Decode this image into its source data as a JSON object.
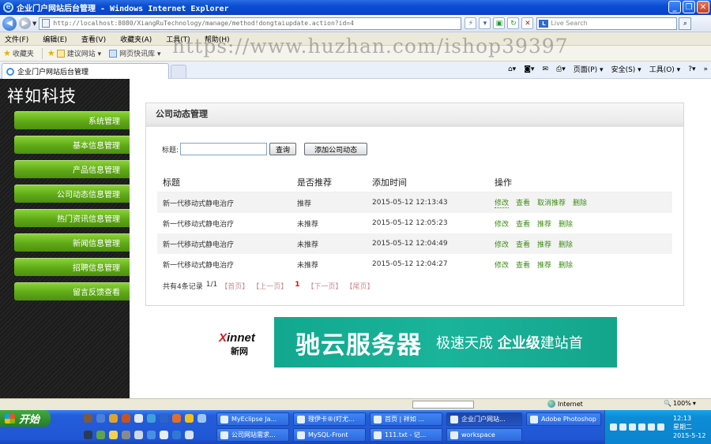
{
  "window": {
    "title": "企业门户网站后台管理 - Windows Internet Explorer",
    "address": "http://localhost:8080/XiangRuTechnology/manage/method!dongtaiupdate.action?id=4",
    "address_host": "localhost",
    "search_placeholder": "Live Search"
  },
  "menubar": [
    "文件(F)",
    "编辑(E)",
    "查看(V)",
    "收藏夹(A)",
    "工具(T)",
    "帮助(H)"
  ],
  "favorites": {
    "label": "收藏夹",
    "items": [
      "建议网站 ▾",
      "网页快讯库 ▾"
    ]
  },
  "watermark": "https://www.huzhan.com/ishop39397",
  "tab": {
    "title": "企业门户网站后台管理"
  },
  "tools": [
    "页面(P) ▾",
    "安全(S) ▾",
    "工具(O) ▾"
  ],
  "sidebar": {
    "brand": "祥如科技",
    "items": [
      "系统管理",
      "基本信息管理",
      "产品信息管理",
      "公司动态信息管理",
      "热门资讯信息管理",
      "新闻信息管理",
      "招聘信息管理",
      "留言反馈查看"
    ]
  },
  "panel": {
    "title": "公司动态管理",
    "search_label": "标题:",
    "search_value": "",
    "query_button": "查询",
    "add_button": "添加公司动态",
    "columns": [
      "标题",
      "是否推荐",
      "添加时间",
      "操作"
    ],
    "rows": [
      {
        "title": "新一代移动式静电治疗",
        "recommend": "推荐",
        "time": "2015-05-12 12:13:43",
        "ops": [
          "修改",
          "查看",
          "取消推荐",
          "删除"
        ]
      },
      {
        "title": "新一代移动式静电治疗",
        "recommend": "未推荐",
        "time": "2015-05-12 12:05:23",
        "ops": [
          "修改",
          "查看",
          "推荐",
          "删除"
        ]
      },
      {
        "title": "新一代移动式静电治疗",
        "recommend": "未推荐",
        "time": "2015-05-12 12:04:49",
        "ops": [
          "修改",
          "查看",
          "推荐",
          "删除"
        ]
      },
      {
        "title": "新一代移动式静电治疗",
        "recommend": "未推荐",
        "time": "2015-05-12 12:04:27",
        "ops": [
          "修改",
          "查看",
          "推荐",
          "删除"
        ]
      }
    ],
    "pager": {
      "summary": "共有4条记录",
      "pages": "1/1",
      "first": "【首页】",
      "prev": "【上一页】",
      "current": "1",
      "next": "【下一页】",
      "last": "【尾页】"
    }
  },
  "banner": {
    "logo_main": "innet",
    "logo_x": "X",
    "logo_sub": "新网",
    "brand": "驰云服务器",
    "tagline_a": "极速天成",
    "tagline_b": "企业级",
    "tagline_c": "建站首"
  },
  "statusbar": {
    "zone": "Internet",
    "zoom": "100%"
  },
  "taskbar": {
    "start": "开始",
    "tasks": [
      {
        "label": "MyEclipse Ja..."
      },
      {
        "label": "理伊卡®(叮尤..."
      },
      {
        "label": "首页 | 祥如 ..."
      },
      {
        "label": "企业门户网站..."
      },
      {
        "label": "Adobe Photoshop"
      },
      {
        "label": "公司网站需求..."
      },
      {
        "label": "MySQL-Front"
      },
      {
        "label": "111.txt - 记..."
      },
      {
        "label": "workspace"
      }
    ],
    "clock_time": "12:13",
    "clock_day": "星期二",
    "clock_date": "2015-5-12"
  },
  "colors": {
    "menu_green": "#5faa17",
    "op_green": "#3c8d14",
    "ad_teal": "#14a58c"
  }
}
